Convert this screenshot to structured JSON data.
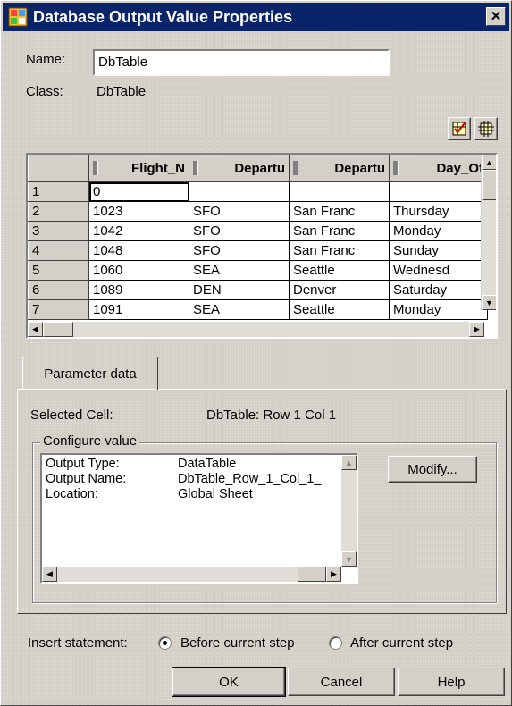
{
  "window": {
    "title": "Database Output Value Properties",
    "close_glyph": "✕",
    "icon": "database-properties-icon"
  },
  "fields": {
    "name_label": "Name:",
    "name_value": "DbTable",
    "class_label": "Class:",
    "class_value": "DbTable"
  },
  "toolbar": {
    "check_all_icon": "check-grid-icon",
    "clear_all_icon": "uncheck-grid-icon"
  },
  "grid": {
    "columns": [
      "Flight_N",
      "Departu",
      "Departu",
      "Day_Of"
    ],
    "rows": [
      {
        "num": "1",
        "cells": [
          "0",
          "",
          "",
          ""
        ]
      },
      {
        "num": "2",
        "cells": [
          "1023",
          "SFO",
          "San Franc",
          "Thursday"
        ]
      },
      {
        "num": "3",
        "cells": [
          "1042",
          "SFO",
          "San Franc",
          "Monday"
        ]
      },
      {
        "num": "4",
        "cells": [
          "1048",
          "SFO",
          "San Franc",
          "Sunday"
        ]
      },
      {
        "num": "5",
        "cells": [
          "1060",
          "SEA",
          "Seattle",
          "Wednesd"
        ]
      },
      {
        "num": "6",
        "cells": [
          "1089",
          "DEN",
          "Denver",
          "Saturday"
        ]
      },
      {
        "num": "7",
        "cells": [
          "1091",
          "SEA",
          "Seattle",
          "Monday"
        ]
      }
    ]
  },
  "tab": {
    "label": "Parameter data"
  },
  "parameter": {
    "selected_cell_label": "Selected Cell:",
    "selected_cell_value": "DbTable: Row 1 Col 1",
    "configure_legend": "Configure value",
    "config_items": [
      {
        "key": "Output Type:",
        "value": "DataTable"
      },
      {
        "key": "Output Name:",
        "value": "DbTable_Row_1_Col_1_"
      },
      {
        "key": "Location:",
        "value": "Global Sheet"
      }
    ],
    "modify_label": "Modify..."
  },
  "insert": {
    "label": "Insert statement:",
    "options": [
      {
        "label": "Before current step",
        "selected": true
      },
      {
        "label": "After current step",
        "selected": false
      }
    ]
  },
  "buttons": {
    "ok": "OK",
    "cancel": "Cancel",
    "help": "Help"
  }
}
